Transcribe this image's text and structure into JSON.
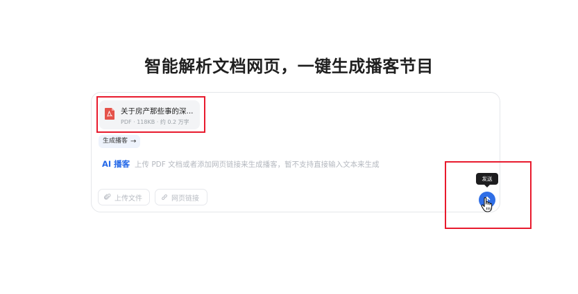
{
  "headline": "智能解析文档网页，一键生成播客节目",
  "file": {
    "name": "关于房产那些事的深...",
    "meta": "PDF · 118KB · 约 0.2 万字",
    "icon": "pdf-icon"
  },
  "generate_button": {
    "label": "生成播客",
    "arrow": "→"
  },
  "input": {
    "ai_label": "AI 播客",
    "placeholder": "上传 PDF 文档或者添加网页链接来生成播客，暂不支持直接输入文本来生成"
  },
  "toolbar": {
    "upload_label": "上传文件",
    "link_label": "网页链接"
  },
  "send": {
    "tooltip": "发送",
    "icon": "arrow-up-icon"
  },
  "colors": {
    "accent": "#2f6ee6",
    "ai_label": "#2468e8",
    "highlight": "#e8192c",
    "pdf_red": "#e5534b"
  }
}
